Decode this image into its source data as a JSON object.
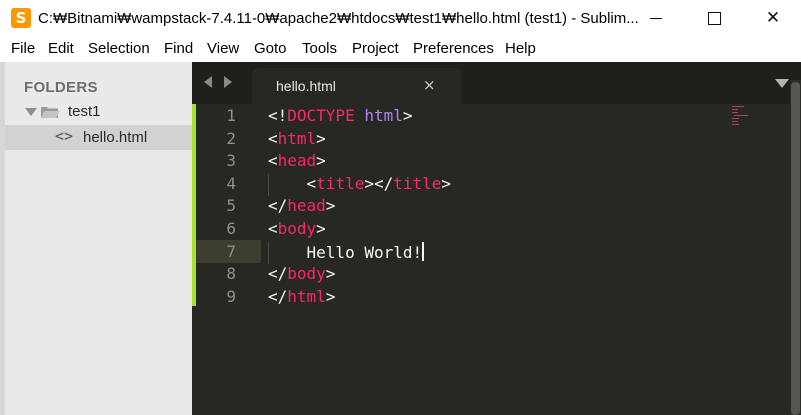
{
  "window": {
    "title": "C:₩Bitnami₩wampstack-7.4.11-0₩apache2₩htdocs₩test1₩hello.html (test1) - Sublim...",
    "app_icon": "sublime-text-icon",
    "app_icon_glyph": "S",
    "minimize_icon": "minimize-icon",
    "maximize_icon": "maximize-icon",
    "close_glyph": "✕"
  },
  "menu": [
    "File",
    "Edit",
    "Selection",
    "Find",
    "View",
    "Goto",
    "Tools",
    "Project",
    "Preferences",
    "Help"
  ],
  "sidebar": {
    "title": "FOLDERS",
    "folder": {
      "name": "test1",
      "icon": "folder-open-icon",
      "expanded": true
    },
    "file": {
      "name": "hello.html",
      "icon_glyph": "<>",
      "selected": true
    }
  },
  "tabs": {
    "active": {
      "label": "hello.html",
      "close_glyph": "×"
    }
  },
  "editor": {
    "line_numbers": [
      "1",
      "2",
      "3",
      "4",
      "5",
      "6",
      "7",
      "8",
      "9"
    ],
    "active_line": "7",
    "code": [
      [
        [
          "br",
          "<!"
        ],
        [
          "tag",
          "DOCTYPE"
        ],
        [
          "br",
          " "
        ],
        [
          "doc",
          "html"
        ],
        [
          "br",
          ">"
        ]
      ],
      [
        [
          "br",
          "<"
        ],
        [
          "tag",
          "html"
        ],
        [
          "br",
          ">"
        ]
      ],
      [
        [
          "br",
          "<"
        ],
        [
          "tag",
          "head"
        ],
        [
          "br",
          ">"
        ]
      ],
      [
        [
          "br",
          "    <"
        ],
        [
          "tag",
          "title"
        ],
        [
          "br",
          "></"
        ],
        [
          "tag",
          "title"
        ],
        [
          "br",
          ">"
        ]
      ],
      [
        [
          "br",
          "</"
        ],
        [
          "tag",
          "head"
        ],
        [
          "br",
          ">"
        ]
      ],
      [
        [
          "br",
          "<"
        ],
        [
          "tag",
          "body"
        ],
        [
          "br",
          ">"
        ]
      ],
      [
        [
          "text",
          "    Hello World!"
        ]
      ],
      [
        [
          "br",
          "</"
        ],
        [
          "tag",
          "body"
        ],
        [
          "br",
          ">"
        ]
      ],
      [
        [
          "br",
          "</"
        ],
        [
          "tag",
          "html"
        ],
        [
          "br",
          ">"
        ]
      ]
    ]
  },
  "colors": {
    "editor_bg": "#272822",
    "tag": "#f92672",
    "doctype_keyword": "#ae81ff",
    "text": "#f8f8f2",
    "modified_gutter": "#a6e22e",
    "sidebar_bg": "#e9e9e9"
  }
}
